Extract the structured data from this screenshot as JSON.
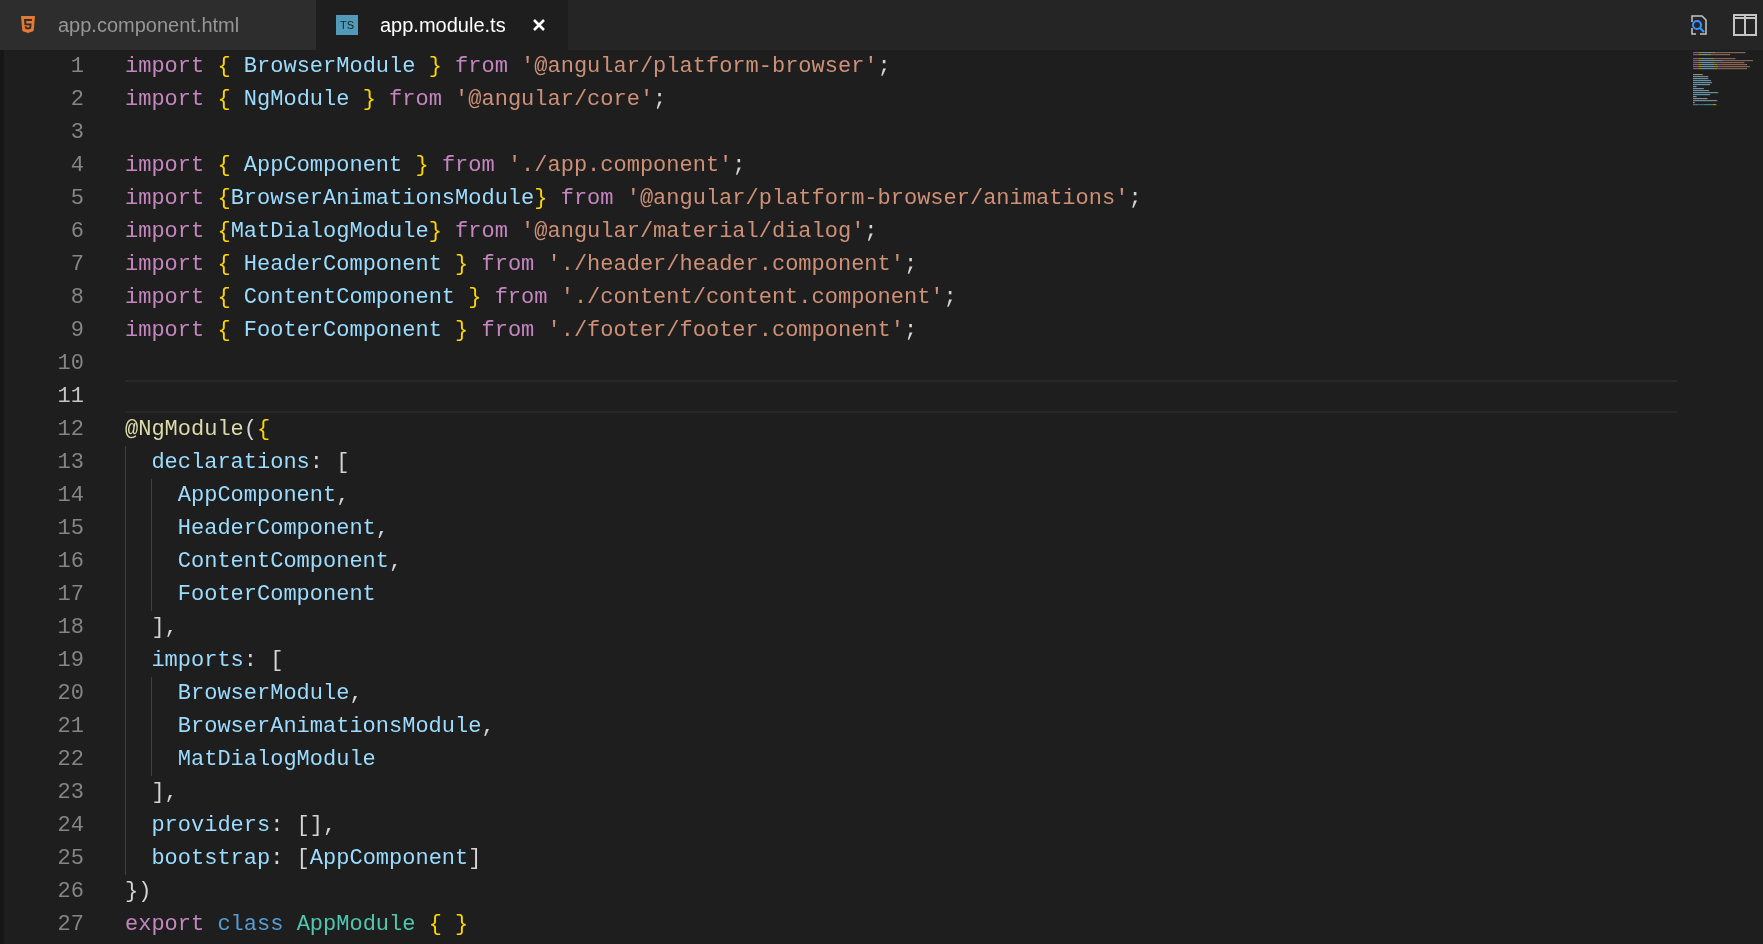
{
  "tabs": [
    {
      "label": "app.component.html",
      "kind": "html",
      "selected": false
    },
    {
      "label": "app.module.ts",
      "kind": "ts",
      "badge": "TS",
      "selected": true
    }
  ],
  "lines": [
    {
      "number": "1",
      "selected": false,
      "tokens": [
        {
          "t": "import",
          "kind": "keyword"
        },
        {
          "t": " { ",
          "kind": "brace"
        },
        {
          "t": "BrowserModule",
          "kind": "ident"
        },
        {
          "t": " } ",
          "kind": "brace"
        },
        {
          "t": "from",
          "kind": "keyword"
        },
        {
          "t": " '@angular/platform-browser'",
          "kind": "string"
        },
        {
          "t": ";",
          "kind": "punct"
        }
      ]
    },
    {
      "number": "2",
      "selected": false,
      "tokens": [
        {
          "t": "import",
          "kind": "keyword"
        },
        {
          "t": " { ",
          "kind": "brace"
        },
        {
          "t": "NgModule",
          "kind": "ident"
        },
        {
          "t": " } ",
          "kind": "brace"
        },
        {
          "t": "from",
          "kind": "keyword"
        },
        {
          "t": " '@angular/core'",
          "kind": "string"
        },
        {
          "t": ";",
          "kind": "punct"
        }
      ]
    },
    {
      "number": "3",
      "selected": false
    },
    {
      "number": "4",
      "selected": false,
      "tokens": [
        {
          "t": "import",
          "kind": "keyword"
        },
        {
          "t": " { ",
          "kind": "brace"
        },
        {
          "t": "AppComponent",
          "kind": "ident"
        },
        {
          "t": " } ",
          "kind": "brace"
        },
        {
          "t": "from",
          "kind": "keyword"
        },
        {
          "t": " './app.component'",
          "kind": "string"
        },
        {
          "t": ";",
          "kind": "punct"
        }
      ]
    },
    {
      "number": "5",
      "selected": false,
      "tokens": [
        {
          "t": "import",
          "kind": "keyword"
        },
        {
          "t": " {",
          "kind": "brace"
        },
        {
          "t": "BrowserAnimationsModule",
          "kind": "ident"
        },
        {
          "t": "} ",
          "kind": "brace"
        },
        {
          "t": "from",
          "kind": "keyword"
        },
        {
          "t": " '@angular/platform-browser/animations'",
          "kind": "string"
        },
        {
          "t": ";",
          "kind": "punct"
        }
      ]
    },
    {
      "number": "6",
      "selected": false,
      "tokens": [
        {
          "t": "import",
          "kind": "keyword"
        },
        {
          "t": " {",
          "kind": "brace"
        },
        {
          "t": "MatDialogModule",
          "kind": "ident"
        },
        {
          "t": "} ",
          "kind": "brace"
        },
        {
          "t": "from",
          "kind": "keyword"
        },
        {
          "t": " '@angular/material/dialog'",
          "kind": "string"
        },
        {
          "t": ";",
          "kind": "punct"
        }
      ]
    },
    {
      "number": "7",
      "selected": false,
      "tokens": [
        {
          "t": "import",
          "kind": "keyword"
        },
        {
          "t": " { ",
          "kind": "brace"
        },
        {
          "t": "HeaderComponent",
          "kind": "ident"
        },
        {
          "t": " } ",
          "kind": "brace"
        },
        {
          "t": "from",
          "kind": "keyword"
        },
        {
          "t": " './header/header.component'",
          "kind": "string"
        },
        {
          "t": ";",
          "kind": "punct"
        }
      ]
    },
    {
      "number": "8",
      "selected": false,
      "tokens": [
        {
          "t": "import",
          "kind": "keyword"
        },
        {
          "t": " { ",
          "kind": "brace"
        },
        {
          "t": "ContentComponent",
          "kind": "ident"
        },
        {
          "t": " } ",
          "kind": "brace"
        },
        {
          "t": "from",
          "kind": "keyword"
        },
        {
          "t": " './content/content.component'",
          "kind": "string"
        },
        {
          "t": ";",
          "kind": "punct"
        }
      ]
    },
    {
      "number": "9",
      "selected": false,
      "tokens": [
        {
          "t": "import",
          "kind": "keyword"
        },
        {
          "t": " { ",
          "kind": "brace"
        },
        {
          "t": "FooterComponent",
          "kind": "ident"
        },
        {
          "t": " } ",
          "kind": "brace"
        },
        {
          "t": "from",
          "kind": "keyword"
        },
        {
          "t": " './footer/footer.component'",
          "kind": "string"
        },
        {
          "t": ";",
          "kind": "punct"
        }
      ]
    },
    {
      "number": "10",
      "selected": false
    },
    {
      "number": "11",
      "selected": true
    },
    {
      "number": "12",
      "selected": false,
      "tokens": [
        {
          "t": "@NgModule",
          "kind": "func"
        },
        {
          "t": "(",
          "kind": "punct"
        },
        {
          "t": "{",
          "kind": "brace"
        }
      ]
    },
    {
      "number": "13",
      "selected": false,
      "tokens": [
        {
          "t": "  declarations",
          "kind": "ident"
        },
        {
          "t": ": [",
          "kind": "punct"
        }
      ]
    },
    {
      "number": "14",
      "selected": false,
      "tokens": [
        {
          "t": "    AppComponent",
          "kind": "ident"
        },
        {
          "t": ",",
          "kind": "punct"
        }
      ]
    },
    {
      "number": "15",
      "selected": false,
      "tokens": [
        {
          "t": "    HeaderComponent",
          "kind": "ident"
        },
        {
          "t": ",",
          "kind": "punct"
        }
      ]
    },
    {
      "number": "16",
      "selected": false,
      "tokens": [
        {
          "t": "    ContentComponent",
          "kind": "ident"
        },
        {
          "t": ",",
          "kind": "punct"
        }
      ]
    },
    {
      "number": "17",
      "selected": false,
      "tokens": [
        {
          "t": "    FooterComponent",
          "kind": "ident"
        }
      ]
    },
    {
      "number": "18",
      "selected": false,
      "tokens": [
        {
          "t": "  ],",
          "kind": "punct"
        }
      ]
    },
    {
      "number": "19",
      "selected": false,
      "tokens": [
        {
          "t": "  imports",
          "kind": "ident"
        },
        {
          "t": ": [",
          "kind": "punct"
        }
      ]
    },
    {
      "number": "20",
      "selected": false,
      "tokens": [
        {
          "t": "    BrowserModule",
          "kind": "ident"
        },
        {
          "t": ",",
          "kind": "punct"
        }
      ]
    },
    {
      "number": "21",
      "selected": false,
      "tokens": [
        {
          "t": "    BrowserAnimationsModule",
          "kind": "ident"
        },
        {
          "t": ",",
          "kind": "punct"
        }
      ]
    },
    {
      "number": "22",
      "selected": false,
      "tokens": [
        {
          "t": "    MatDialogModule",
          "kind": "ident"
        }
      ]
    },
    {
      "number": "23",
      "selected": false,
      "tokens": [
        {
          "t": "  ],",
          "kind": "punct"
        }
      ]
    },
    {
      "number": "24",
      "selected": false,
      "tokens": [
        {
          "t": "  providers",
          "kind": "ident"
        },
        {
          "t": ": [],",
          "kind": "punct"
        }
      ]
    },
    {
      "number": "25",
      "selected": false,
      "tokens": [
        {
          "t": "  bootstrap",
          "kind": "ident"
        },
        {
          "t": ": [",
          "kind": "punct"
        },
        {
          "t": "AppComponent",
          "kind": "ident"
        },
        {
          "t": "]",
          "kind": "punct"
        }
      ]
    },
    {
      "number": "26",
      "selected": false,
      "tokens": [
        {
          "t": "})",
          "kind": "punct"
        }
      ]
    },
    {
      "number": "27",
      "selected": false,
      "tokens": [
        {
          "t": "export",
          "kind": "keyword"
        },
        {
          "t": " class",
          "kind": "storage"
        },
        {
          "t": " AppModule",
          "kind": "type"
        },
        {
          "t": " { }",
          "kind": "brace"
        }
      ]
    }
  ]
}
